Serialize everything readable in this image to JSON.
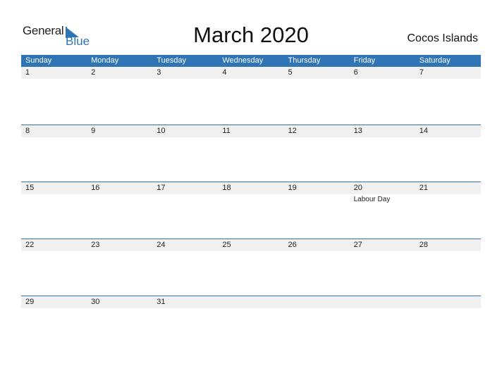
{
  "logo": {
    "general": "General",
    "blue": "Blue"
  },
  "title": "March 2020",
  "country": "Cocos Islands",
  "colors": {
    "accent": "#2f74b5",
    "band": "#f0f0f0"
  },
  "weekdays": [
    "Sunday",
    "Monday",
    "Tuesday",
    "Wednesday",
    "Thursday",
    "Friday",
    "Saturday"
  ],
  "weeks": [
    {
      "days": [
        "1",
        "2",
        "3",
        "4",
        "5",
        "6",
        "7"
      ],
      "events": [
        "",
        "",
        "",
        "",
        "",
        "",
        ""
      ]
    },
    {
      "days": [
        "8",
        "9",
        "10",
        "11",
        "12",
        "13",
        "14"
      ],
      "events": [
        "",
        "",
        "",
        "",
        "",
        "",
        ""
      ]
    },
    {
      "days": [
        "15",
        "16",
        "17",
        "18",
        "19",
        "20",
        "21"
      ],
      "events": [
        "",
        "",
        "",
        "",
        "",
        "Labour Day",
        ""
      ]
    },
    {
      "days": [
        "22",
        "23",
        "24",
        "25",
        "26",
        "27",
        "28"
      ],
      "events": [
        "",
        "",
        "",
        "",
        "",
        "",
        ""
      ]
    },
    {
      "days": [
        "29",
        "30",
        "31",
        "",
        "",
        "",
        ""
      ],
      "events": [
        "",
        "",
        "",
        "",
        "",
        "",
        ""
      ]
    }
  ]
}
